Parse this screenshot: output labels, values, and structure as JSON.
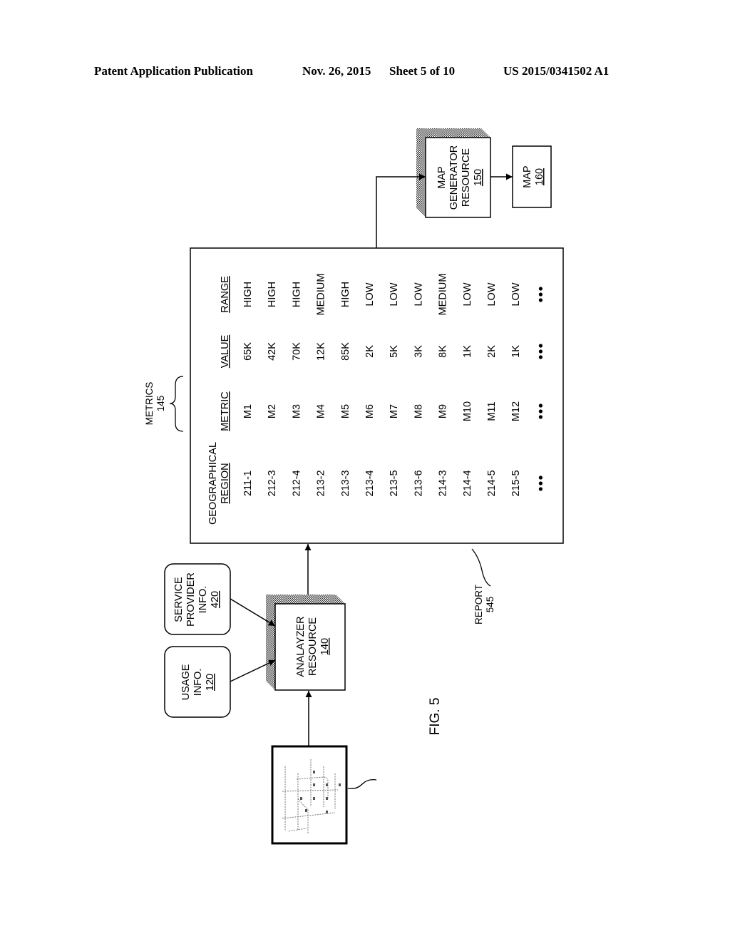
{
  "header": {
    "publication": "Patent Application Publication",
    "date": "Nov. 26, 2015",
    "sheet": "Sheet 5 of 10",
    "number": "US 2015/0341502 A1"
  },
  "figure_label": "FIG. 5",
  "nodes": {
    "map_image": {
      "label": "map-image",
      "icon": "street-map-thumbnail"
    },
    "usage_info": {
      "lines": [
        "USAGE",
        "INFO."
      ],
      "ref": "120"
    },
    "service_provider_info": {
      "lines": [
        "SERVICE",
        "PROVIDER",
        "INFO."
      ],
      "ref": "420"
    },
    "analyzer_resource": {
      "lines": [
        "ANALAYZER",
        "RESOURCE"
      ],
      "ref": "140"
    },
    "map_generator_resource": {
      "lines": [
        "MAP",
        "GENERATOR",
        "RESOURCE"
      ],
      "ref": "150"
    },
    "map": {
      "lines": [
        "MAP"
      ],
      "ref": "160"
    }
  },
  "report": {
    "label": "REPORT",
    "ref": "545",
    "metrics_label": "METRICS",
    "metrics_ref": "145",
    "columns": [
      {
        "key": "region",
        "header_lines": [
          "GEOGRAPHICAL",
          "REGION"
        ]
      },
      {
        "key": "metric",
        "header_lines": [
          "METRIC"
        ]
      },
      {
        "key": "value",
        "header_lines": [
          "VALUE"
        ]
      },
      {
        "key": "range",
        "header_lines": [
          "RANGE"
        ]
      }
    ],
    "rows": [
      {
        "region": "211-1",
        "metric": "M1",
        "value": "65K",
        "range": "HIGH"
      },
      {
        "region": "212-3",
        "metric": "M2",
        "value": "42K",
        "range": "HIGH"
      },
      {
        "region": "212-4",
        "metric": "M3",
        "value": "70K",
        "range": "HIGH"
      },
      {
        "region": "213-2",
        "metric": "M4",
        "value": "12K",
        "range": "MEDIUM"
      },
      {
        "region": "213-3",
        "metric": "M5",
        "value": "85K",
        "range": "HIGH"
      },
      {
        "region": "213-4",
        "metric": "M6",
        "value": "2K",
        "range": "LOW"
      },
      {
        "region": "213-5",
        "metric": "M7",
        "value": "5K",
        "range": "LOW"
      },
      {
        "region": "213-6",
        "metric": "M8",
        "value": "3K",
        "range": "LOW"
      },
      {
        "region": "214-3",
        "metric": "M9",
        "value": "8K",
        "range": "MEDIUM"
      },
      {
        "region": "214-4",
        "metric": "M10",
        "value": "1K",
        "range": "LOW"
      },
      {
        "region": "214-5",
        "metric": "M11",
        "value": "2K",
        "range": "LOW"
      },
      {
        "region": "215-5",
        "metric": "M12",
        "value": "1K",
        "range": "LOW"
      }
    ],
    "continuation": "…"
  },
  "edges": [
    {
      "from": "map_image",
      "to": "analyzer_resource"
    },
    {
      "from": "usage_info",
      "to": "analyzer_resource"
    },
    {
      "from": "service_provider_info",
      "to": "analyzer_resource"
    },
    {
      "from": "analyzer_resource",
      "to": "report"
    },
    {
      "from": "report",
      "to": "map_generator_resource"
    },
    {
      "from": "map_generator_resource",
      "to": "map"
    }
  ]
}
